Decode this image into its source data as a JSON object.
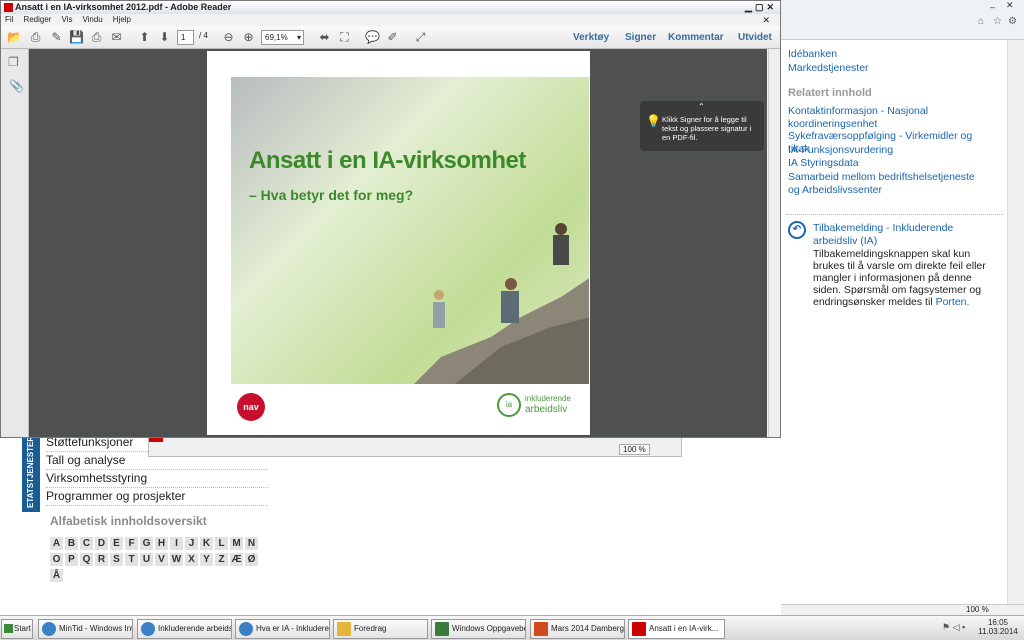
{
  "background_page": {
    "vertical_tab": "ETATSTJENESTER",
    "nav_items": [
      "Støttefunksjoner",
      "Tall og analyse",
      "Virksomhetsstyring",
      "Programmer og prosjekter"
    ],
    "alpha_heading": "Alfabetisk innholdsoversikt",
    "letters": [
      "A",
      "B",
      "C",
      "D",
      "E",
      "F",
      "G",
      "H",
      "I",
      "J",
      "K",
      "L",
      "M",
      "N",
      "O",
      "P",
      "Q",
      "R",
      "S",
      "T",
      "U",
      "V",
      "W",
      "X",
      "Y",
      "Z",
      "Æ",
      "Ø",
      "Å"
    ]
  },
  "ie_secondary": {
    "zoom": "100 %"
  },
  "right_pane": {
    "top_links": [
      "Idébanken",
      "Markedstjenester"
    ],
    "related_heading": "Relatert innhold",
    "related_links": [
      "Kontaktinformasjon - Nasjonal koordineringsenhet",
      "Sykefraværsoppfølging - Virkemidler og tiltak",
      "IA-Funksjonsvurdering",
      "IA Styringsdata",
      "Samarbeid mellom bedriftshelsetjeneste og Arbeidslivssenter"
    ],
    "feedback_title": "Tilbakemelding - Inkluderende arbeidsliv (IA)",
    "feedback_text": "Tilbakemeldingsknappen skal kun brukes til å varsle om direkte feil eller mangler i informasjonen på denne siden. Spørsmål om fagsystemer og endringsønsker meldes til",
    "feedback_link": "Porten.",
    "zoom": "100 %"
  },
  "reader": {
    "title": "Ansatt i en IA-virksomhet 2012.pdf - Adobe Reader",
    "menu": [
      "Fil",
      "Rediger",
      "Vis",
      "Vindu",
      "Hjelp"
    ],
    "page_current": "1",
    "page_total": "/ 4",
    "zoom": "69,1%",
    "right_buttons": [
      "Verktøy",
      "Signer",
      "Kommentar",
      "Utvidet"
    ],
    "tooltip": "Klikk Signer for å legge til tekst og plassere signatur i en PDF-fil.",
    "doc_title": "Ansatt i en IA-virksomhet",
    "doc_subtitle": "– Hva betyr det for meg?",
    "nav_logo": "nav",
    "ia_logo_text1": "inkluderende",
    "ia_logo_text2": "arbeidsliv"
  },
  "taskbar": {
    "start": "Start",
    "buttons": [
      "MinTid - Windows Int...",
      "Inkluderende arbeidsl...",
      "Hva er IA - Inkludere...",
      "Foredrag",
      "Windows Oppgavebe...",
      "Mars 2014 Damberg I...",
      "Ansatt i en IA-virk..."
    ],
    "time": "16:05",
    "date": "11.03.2014"
  }
}
